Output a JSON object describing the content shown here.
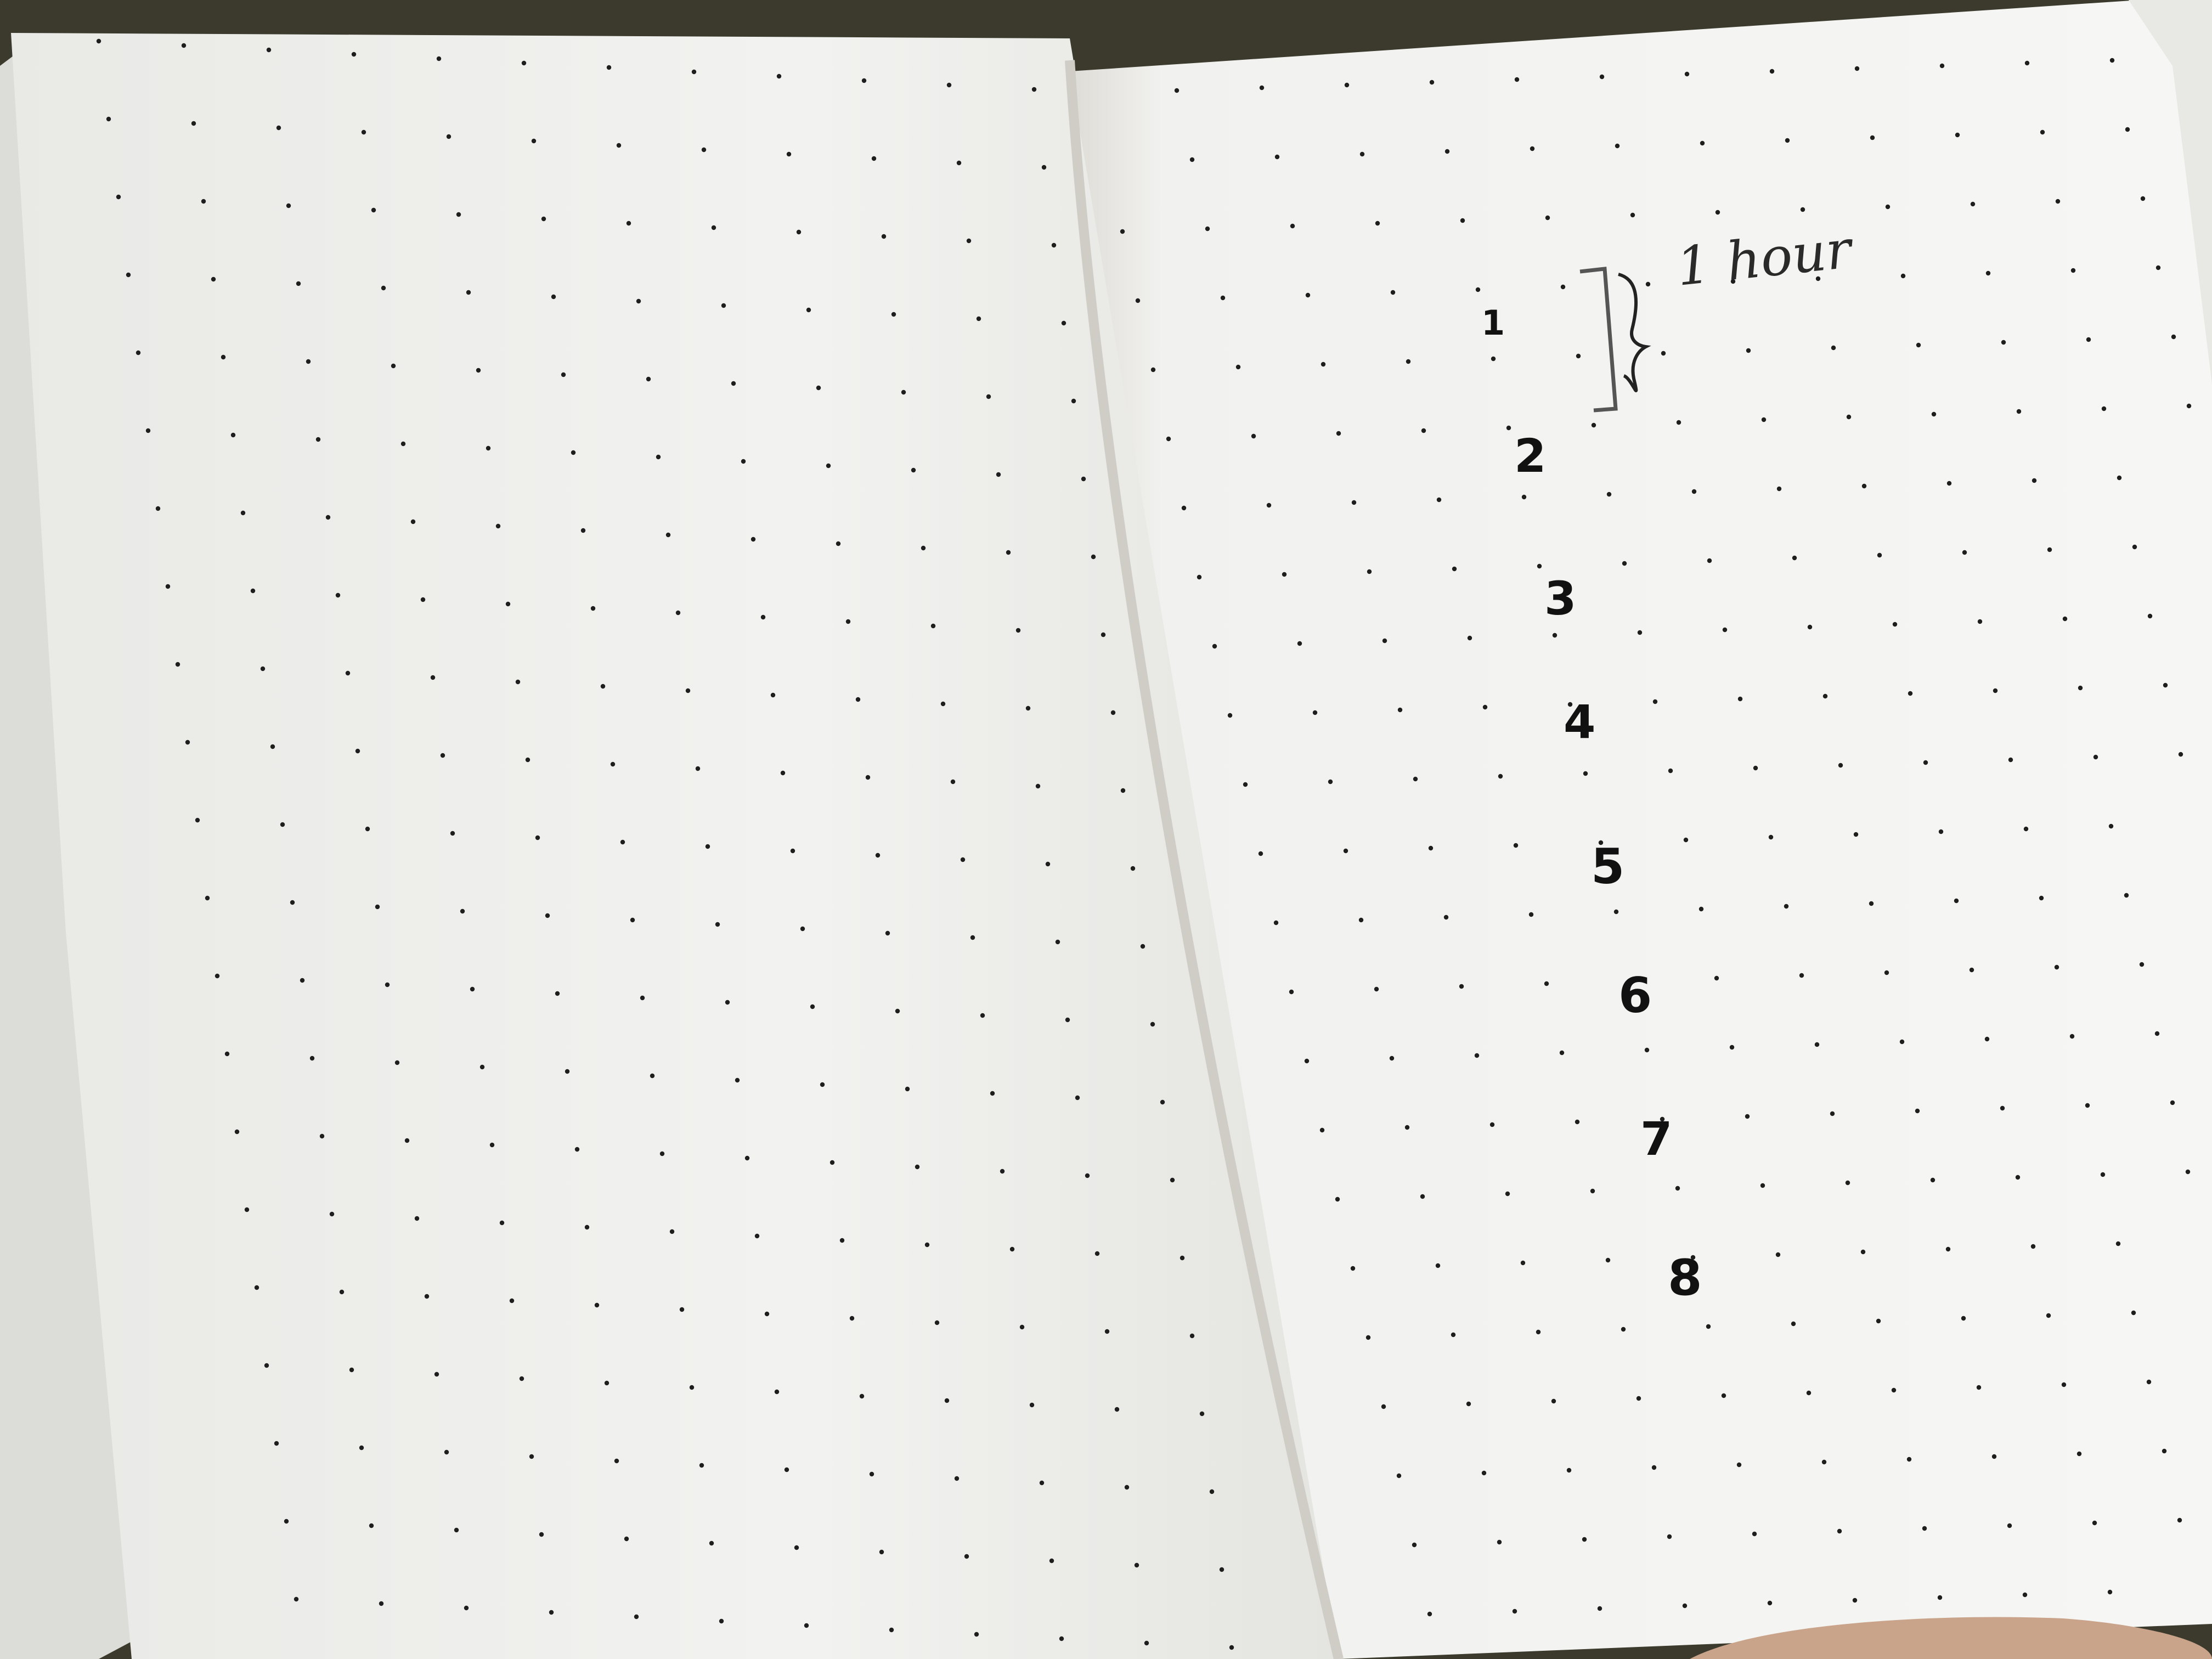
{
  "photo": {
    "subject": "open-dot-grid-notebook",
    "colors": {
      "background": "#3b3a2c",
      "desk": "#8a6a4a",
      "paper_left": "#f1f1ef",
      "paper_right": "#f4f4f2",
      "page_edges": "#dcdcd8",
      "dots": "#1e1e1e",
      "ink": "#111111",
      "pencil": "#555555",
      "thumb": "#c9a48a"
    }
  },
  "right_page": {
    "numbers": [
      "1",
      "2",
      "3",
      "4",
      "5",
      "6",
      "7",
      "8"
    ],
    "annotation": {
      "bracket_icon": "pencil-bracket-icon",
      "brace_icon": "curly-brace-icon",
      "label": "1 hour"
    }
  }
}
